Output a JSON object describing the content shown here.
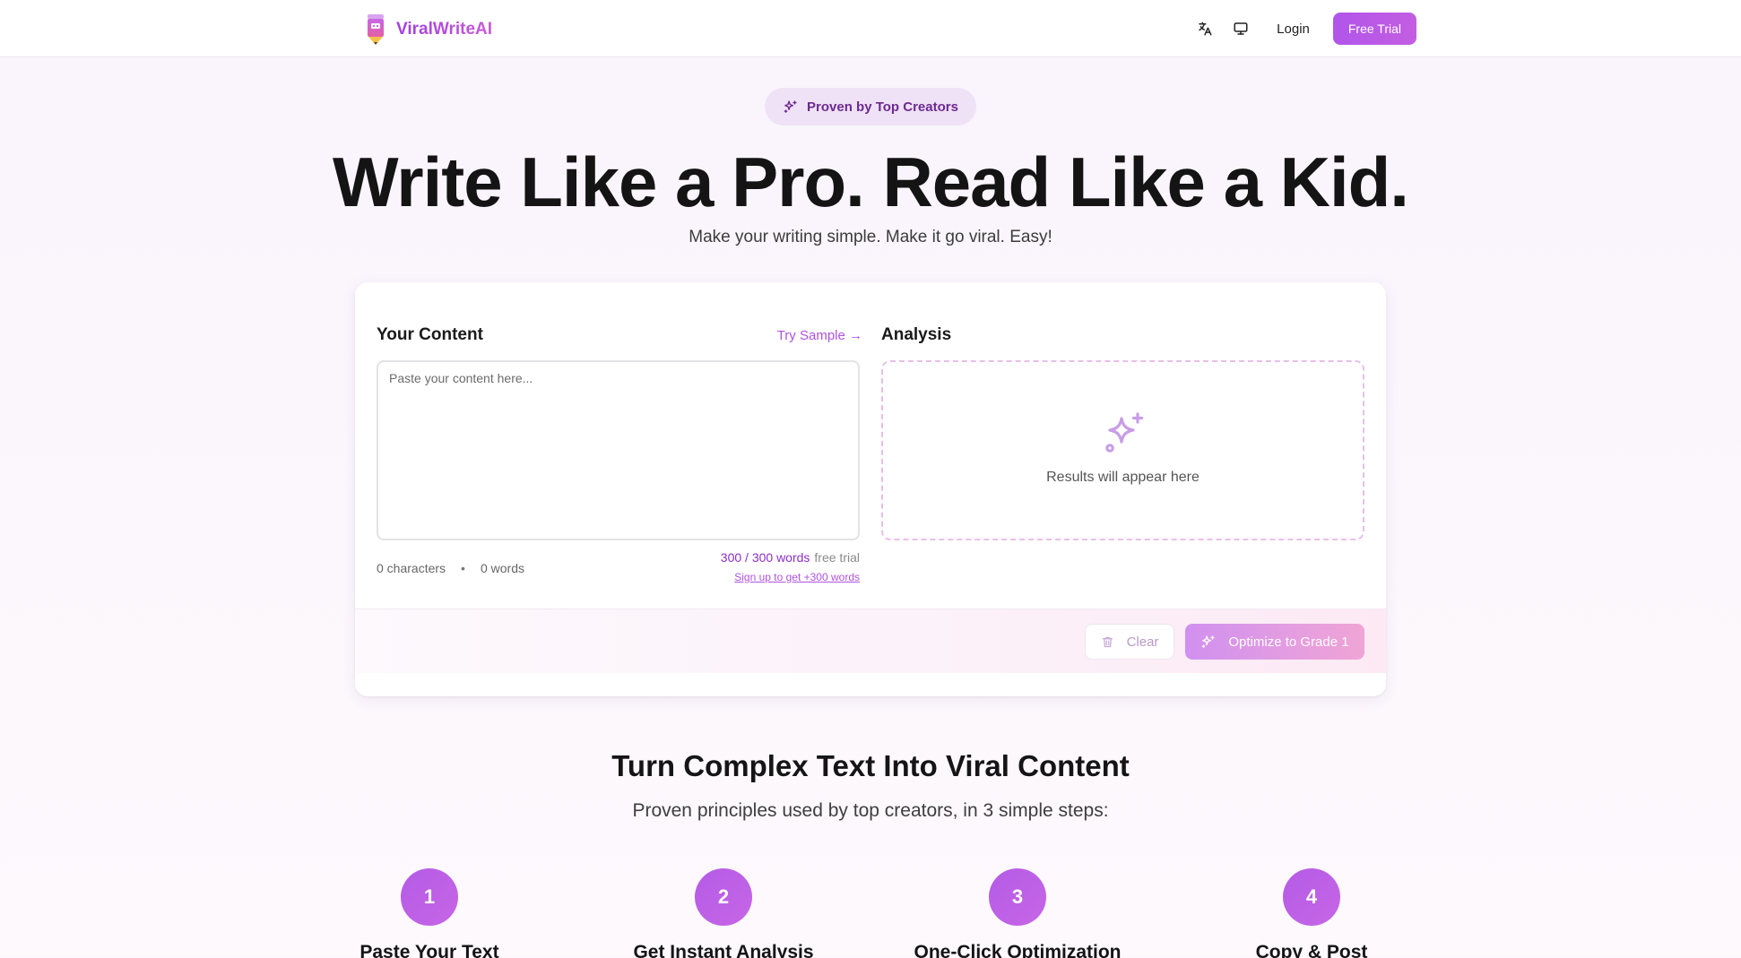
{
  "header": {
    "brand": "ViralWriteAI",
    "icons": [
      "translate-icon",
      "monitor-icon"
    ],
    "login_label": "Login",
    "trial_label": "Free Trial"
  },
  "hero": {
    "badge_label": "Proven by Top Creators",
    "title": "Write Like a Pro. Read Like a Kid.",
    "subtitle": "Make your writing simple. Make it go viral. Easy!"
  },
  "editor": {
    "content_title": "Your Content",
    "try_sample_label": "Try Sample →",
    "textarea_placeholder": "Paste your content here...",
    "textarea_value": "",
    "characters_label": "0 characters",
    "separator": "•",
    "words_label": "0 words",
    "word_limit": "300 / 300 words",
    "word_limit_note": "free trial",
    "signup_link": "Sign up to get +300 words"
  },
  "analysis": {
    "title": "Analysis",
    "placeholder": "Results will appear here"
  },
  "actions": {
    "clear_label": "Clear",
    "optimize_label": "Optimize to Grade 1"
  },
  "steps_section": {
    "title": "Turn Complex Text Into Viral Content",
    "subtitle": "Proven principles used by top creators, in 3 simple steps:",
    "steps": [
      {
        "number": "1",
        "title": "Paste Your Text"
      },
      {
        "number": "2",
        "title": "Get Instant Analysis"
      },
      {
        "number": "3",
        "title": "One-Click Optimization"
      },
      {
        "number": "4",
        "title": "Copy & Post"
      }
    ]
  },
  "colors": {
    "accent": "#b155ea",
    "accent_dark": "#8e2ec6",
    "badge_bg": "#efe1f6"
  }
}
